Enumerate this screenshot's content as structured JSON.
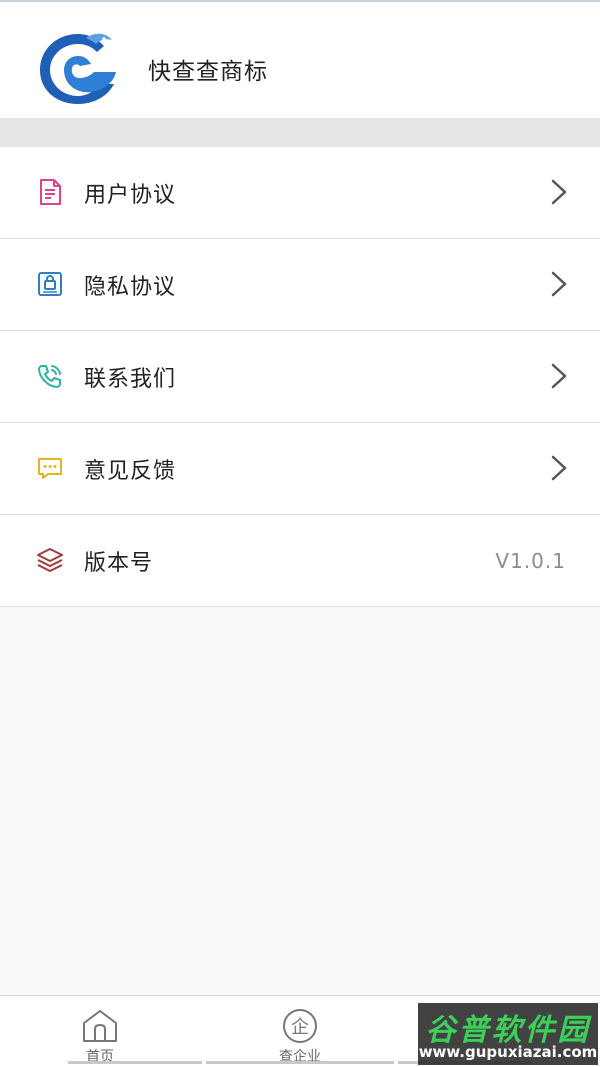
{
  "app": {
    "title": "快查查商标"
  },
  "menu": {
    "items": [
      {
        "label": "用户协议",
        "icon": "document-icon",
        "has_chevron": true
      },
      {
        "label": "隐私协议",
        "icon": "lock-card-icon",
        "has_chevron": true
      },
      {
        "label": "联系我们",
        "icon": "phone-icon",
        "has_chevron": true
      },
      {
        "label": "意见反馈",
        "icon": "chat-icon",
        "has_chevron": true
      },
      {
        "label": "版本号",
        "icon": "layers-icon",
        "value": "V1.0.1",
        "has_chevron": false
      }
    ]
  },
  "tabbar": {
    "tabs": [
      {
        "label": "首页",
        "icon": "home-icon"
      },
      {
        "label": "查企业",
        "icon": "enterprise-icon"
      }
    ]
  },
  "watermark": {
    "title": "谷普软件园",
    "url": "www.gupuxiazai.com"
  },
  "colors": {
    "document_icon": "#e0428a",
    "lock_icon": "#2f7fc4",
    "phone_icon": "#2cb59a",
    "chat_icon": "#e6b422",
    "layers_icon": "#a33a3a",
    "logo_blue": "#1f5fb8"
  }
}
